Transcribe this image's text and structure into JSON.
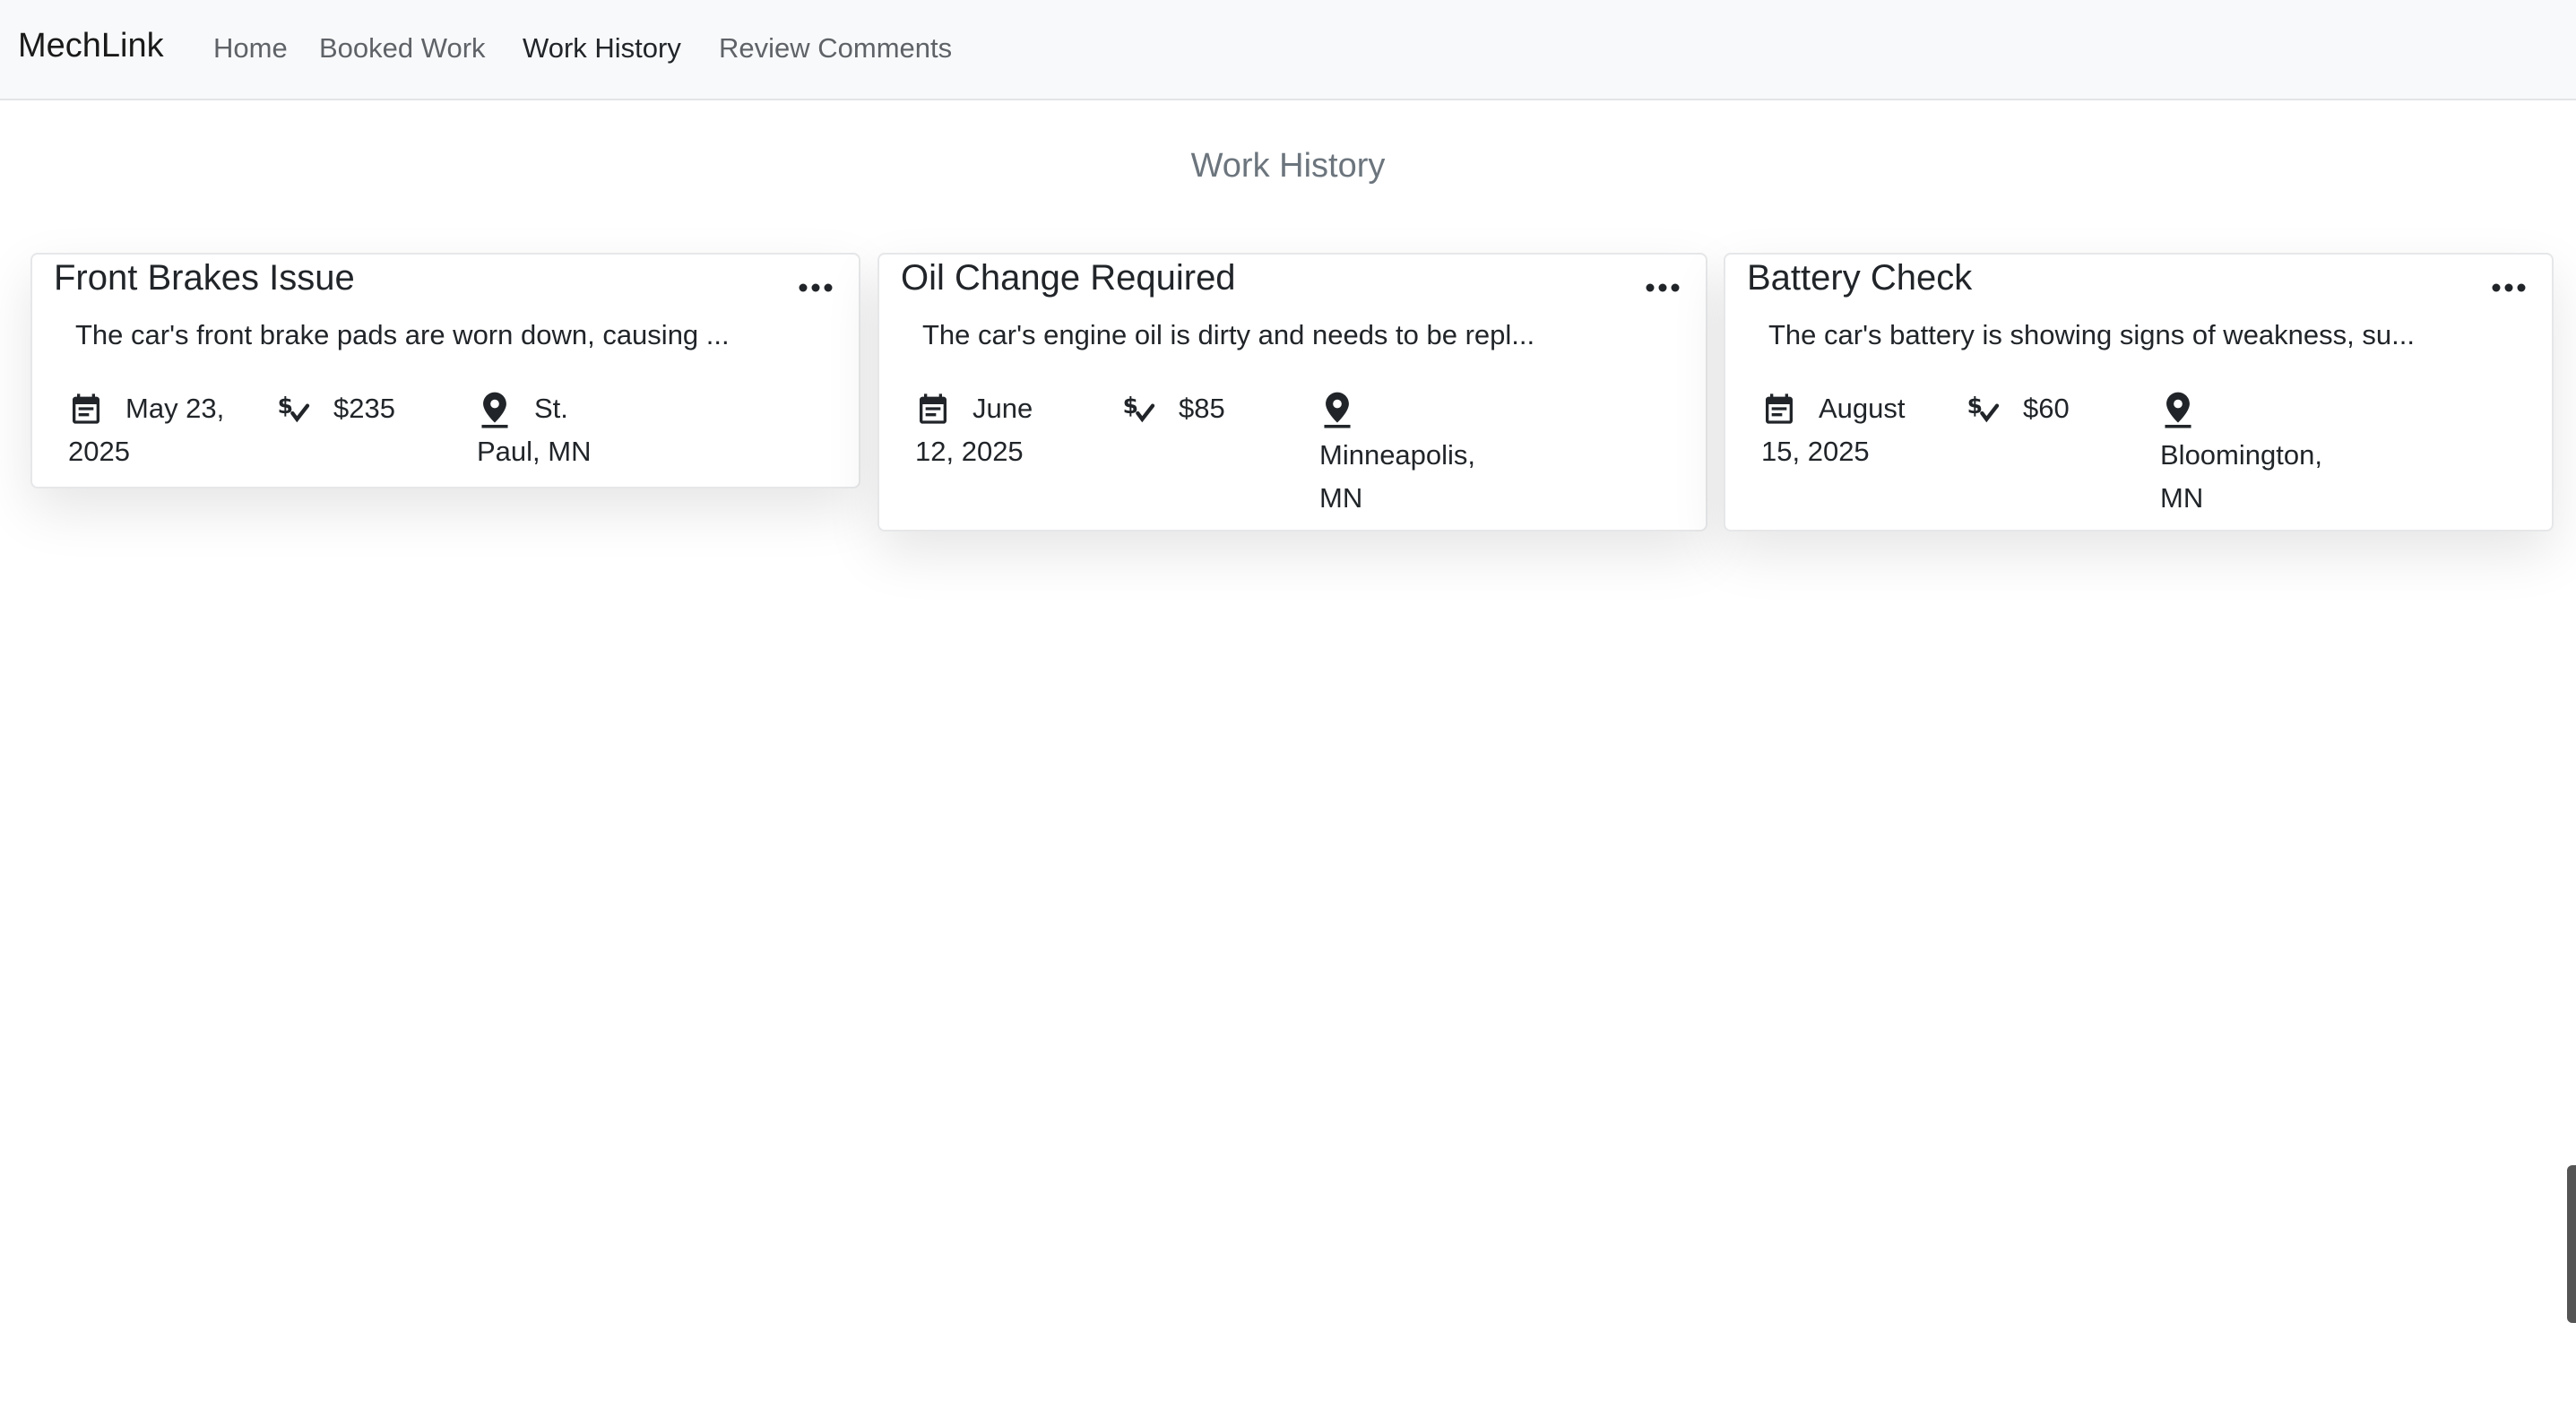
{
  "navbar": {
    "brand": "MechLink",
    "links": [
      {
        "label": "Home"
      },
      {
        "label": "Booked Work"
      },
      {
        "label": "Work History"
      },
      {
        "label": "Review Comments"
      }
    ],
    "active_link": "Work History"
  },
  "page": {
    "title": "Work History"
  },
  "cards": [
    {
      "title": "Front Brakes Issue",
      "description": "The car's front brake pads are worn down, causing ...",
      "date_line1": "May 23,",
      "date_line2": "2025",
      "price": "$235",
      "location_line1": "St.",
      "location_line2": "Paul, MN",
      "menu_icon": "more-horizontal-icon"
    },
    {
      "title": "Oil Change Required",
      "description": "The car's engine oil is dirty and needs to be repl...",
      "date_line1": "June",
      "date_line2": "12, 2025",
      "price": "$85",
      "location_line1": "Minneapolis,",
      "location_line2": "MN",
      "menu_icon": "more-horizontal-icon"
    },
    {
      "title": "Battery Check",
      "description": "The car's battery is showing signs of weakness, su...",
      "date_line1": "August",
      "date_line2": "15, 2025",
      "price": "$60",
      "location_line1": "Bloomington,",
      "location_line2": "MN",
      "menu_icon": "more-horizontal-icon"
    }
  ],
  "icons": {
    "date": "calendar-icon",
    "price": "dollar-check-icon",
    "location": "map-pin-icon"
  },
  "colors": {
    "navbar_bg": "#f8f9fa",
    "text": "#212529",
    "muted": "#6c757d"
  }
}
